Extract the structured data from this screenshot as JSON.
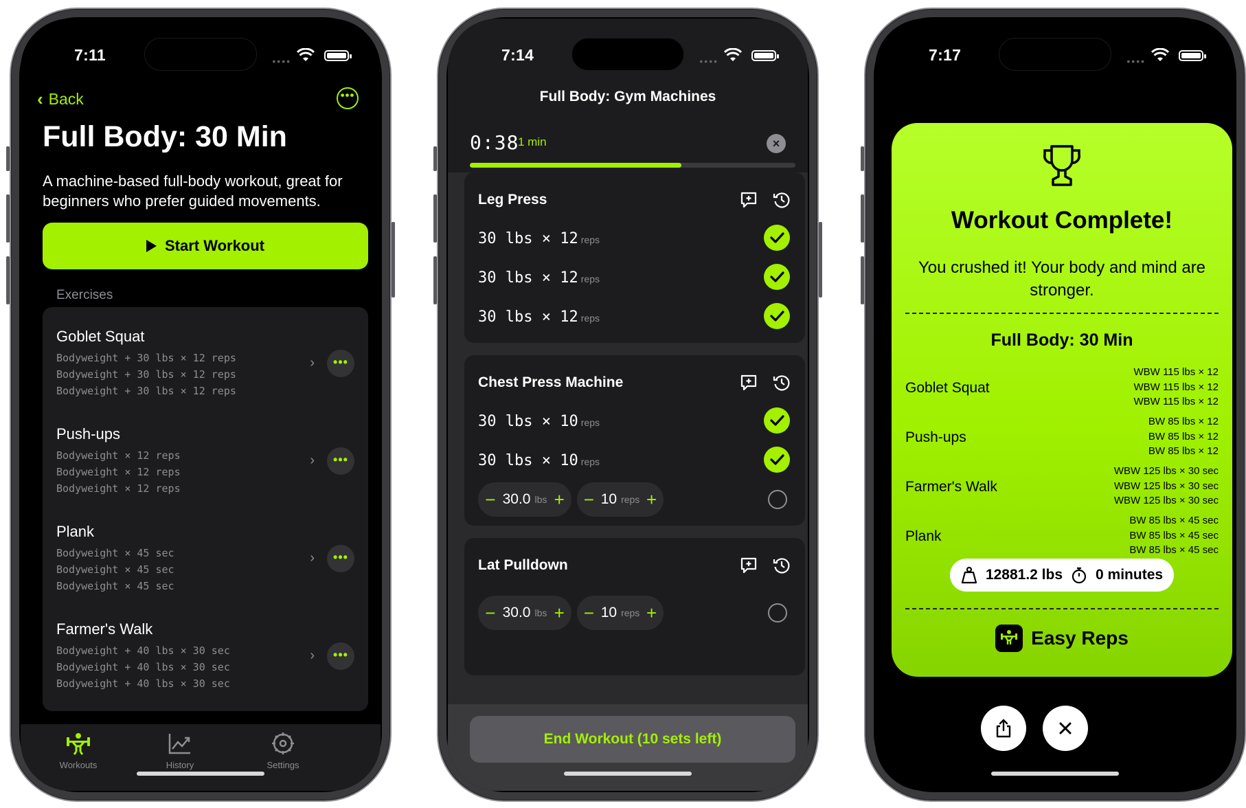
{
  "colors": {
    "accent": "#a3f000",
    "background": "#000000",
    "card": "#1c1c1e"
  },
  "workout_detail": {
    "status_time": "7:11",
    "back_label": "Back",
    "more_icon": "ellipsis-circle-icon",
    "title": "Full Body: 30 Min",
    "description": "A machine-based full-body workout, great for beginners who prefer guided movements.",
    "start_label": "Start Workout",
    "exercises_label": "Exercises",
    "exercises": [
      {
        "name": "Goblet Squat",
        "sets": [
          "Bodyweight + 30 lbs × 12 reps",
          "Bodyweight + 30 lbs × 12 reps",
          "Bodyweight + 30 lbs × 12 reps"
        ]
      },
      {
        "name": "Push-ups",
        "sets": [
          "Bodyweight × 12 reps",
          "Bodyweight × 12 reps",
          "Bodyweight × 12 reps"
        ]
      },
      {
        "name": "Plank",
        "sets": [
          "Bodyweight × 45 sec",
          "Bodyweight × 45 sec",
          "Bodyweight × 45 sec"
        ]
      },
      {
        "name": "Farmer's Walk",
        "sets": [
          "Bodyweight + 40 lbs × 30 sec",
          "Bodyweight + 40 lbs × 30 sec",
          "Bodyweight + 40 lbs × 30 sec"
        ]
      }
    ],
    "tabs": [
      {
        "label": "Workouts",
        "icon": "weightlifter-icon",
        "active": true
      },
      {
        "label": "History",
        "icon": "chart-line-icon",
        "active": false
      },
      {
        "label": "Settings",
        "icon": "gear-icon",
        "active": false
      }
    ]
  },
  "active_workout": {
    "status_time": "7:14",
    "title": "Full Body: Gym Machines",
    "timer": "0:38",
    "timer_label": "1 min",
    "progress": 0.65,
    "exercises": [
      {
        "name": "Leg Press",
        "sets": [
          {
            "weight": "30",
            "weight_unit": "lbs",
            "times": "×",
            "reps": "12",
            "reps_unit": "reps",
            "done": true
          },
          {
            "weight": "30",
            "weight_unit": "lbs",
            "times": "×",
            "reps": "12",
            "reps_unit": "reps",
            "done": true
          },
          {
            "weight": "30",
            "weight_unit": "lbs",
            "times": "×",
            "reps": "12",
            "reps_unit": "reps",
            "done": true
          }
        ]
      },
      {
        "name": "Chest Press Machine",
        "sets": [
          {
            "weight": "30",
            "weight_unit": "lbs",
            "times": "×",
            "reps": "10",
            "reps_unit": "reps",
            "done": true
          },
          {
            "weight": "30",
            "weight_unit": "lbs",
            "times": "×",
            "reps": "10",
            "reps_unit": "reps",
            "done": true
          }
        ],
        "editing": {
          "weight": "30.0",
          "weight_unit": "lbs",
          "reps": "10",
          "reps_unit": "reps"
        }
      },
      {
        "name": "Lat Pulldown",
        "sets": [],
        "editing": {
          "weight": "30.0",
          "weight_unit": "lbs",
          "reps": "10",
          "reps_unit": "reps"
        }
      }
    ],
    "end_label": "End Workout (10 sets left)"
  },
  "summary": {
    "status_time": "7:17",
    "heading": "Workout Complete!",
    "message": "You crushed it! Your body and mind are stronger.",
    "workout_name": "Full Body: 30 Min",
    "exercises": [
      {
        "name": "Goblet Squat",
        "sets": [
          "WBW 115 lbs × 12",
          "WBW 115 lbs × 12",
          "WBW 115 lbs × 12"
        ]
      },
      {
        "name": "Push-ups",
        "sets": [
          "BW 85 lbs × 12",
          "BW 85 lbs × 12",
          "BW 85 lbs × 12"
        ]
      },
      {
        "name": "Farmer's Walk",
        "sets": [
          "WBW 125 lbs × 30 sec",
          "WBW 125 lbs × 30 sec",
          "WBW 125 lbs × 30 sec"
        ]
      },
      {
        "name": "Plank",
        "sets": [
          "BW 85 lbs × 45 sec",
          "BW 85 lbs × 45 sec",
          "BW 85 lbs × 45 sec"
        ]
      }
    ],
    "total_weight": "12881.2 lbs",
    "duration": "0 minutes",
    "brand": "Easy Reps"
  }
}
